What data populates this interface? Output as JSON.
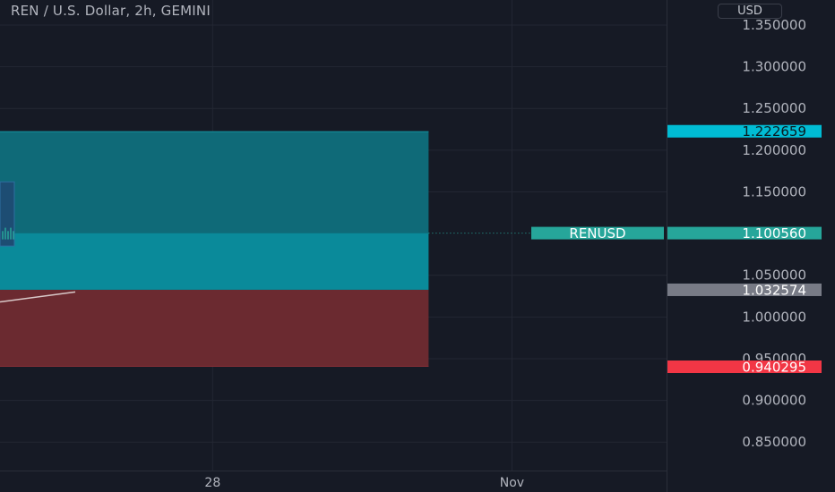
{
  "header": {
    "title": "REN / U.S. Dollar, 2h, GEMINI",
    "currency": "USD"
  },
  "colors": {
    "background": "#161a25",
    "grid": "#232733",
    "axis_text": "#b2b5be",
    "profit_zone": "#0f6a78",
    "profit_zone_lower": "#0a8a9a",
    "stop_zone": "#6b2a30",
    "current_price_badge": "#26a69a",
    "target_badge": "#00bcd4",
    "entry_badge": "#787b86",
    "stop_badge": "#f23645"
  },
  "chart_data": {
    "type": "line",
    "title": "REN / U.S. Dollar, 2h, GEMINI",
    "symbol": "RENUSD",
    "currency": "USD",
    "timeframe": "2h",
    "exchange": "GEMINI",
    "ylim": [
      0.825,
      1.375
    ],
    "grid": true,
    "y_ticks": [
      {
        "value": 1.35,
        "label": "1.350000"
      },
      {
        "value": 1.3,
        "label": "1.300000"
      },
      {
        "value": 1.25,
        "label": "1.250000"
      },
      {
        "value": 1.2,
        "label": "1.200000"
      },
      {
        "value": 1.15,
        "label": "1.150000"
      },
      {
        "value": 1.05,
        "label": "1.050000"
      },
      {
        "value": 1.0,
        "label": "1.000000"
      },
      {
        "value": 0.95,
        "label": "0.950000"
      },
      {
        "value": 0.9,
        "label": "0.900000"
      },
      {
        "value": 0.85,
        "label": "0.850000"
      }
    ],
    "x_ticks": [
      {
        "pos": 0.319,
        "label": "28"
      },
      {
        "pos": 0.768,
        "label": "Nov"
      }
    ],
    "position": {
      "target": 1.222659,
      "entry": 1.032574,
      "stop": 0.940295,
      "start": 0.0,
      "end": 0.643
    },
    "current_price": 1.10056,
    "current_price_label": "RENUSD",
    "price_labels": [
      {
        "value": 1.222659,
        "label": "1.222659",
        "role": "target"
      },
      {
        "value": 1.10056,
        "label": "1.100560",
        "role": "current"
      },
      {
        "value": 1.032574,
        "label": "1.032574",
        "role": "entry"
      },
      {
        "value": 0.940295,
        "label": "0.940295",
        "role": "stop"
      }
    ]
  }
}
